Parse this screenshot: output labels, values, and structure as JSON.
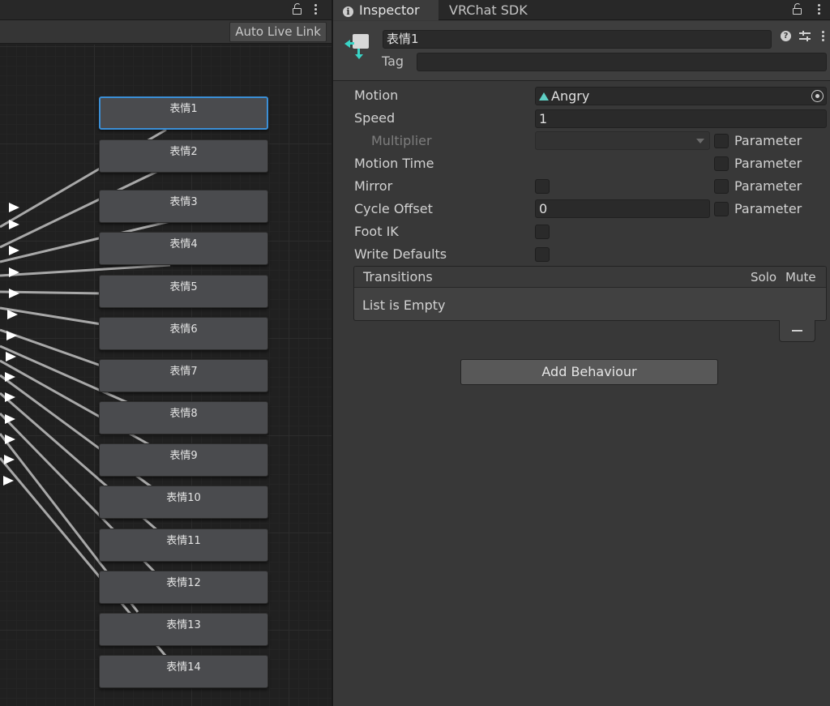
{
  "graph": {
    "auto_live_link_label": "Auto Live Link",
    "states": [
      {
        "name": "表情1",
        "selected": true
      },
      {
        "name": "表情2"
      },
      {
        "name": "表情3"
      },
      {
        "name": "表情4"
      },
      {
        "name": "表情5"
      },
      {
        "name": "表情6"
      },
      {
        "name": "表情7"
      },
      {
        "name": "表情8"
      },
      {
        "name": "表情9"
      },
      {
        "name": "表情10"
      },
      {
        "name": "表情11"
      },
      {
        "name": "表情12"
      },
      {
        "name": "表情13"
      },
      {
        "name": "表情14"
      }
    ]
  },
  "inspector": {
    "tabs": {
      "inspector": "Inspector",
      "vrchat_sdk": "VRChat SDK"
    },
    "header": {
      "state_name": "表情1",
      "tag_label": "Tag",
      "tag_value": ""
    },
    "properties": {
      "motion_label": "Motion",
      "motion_value": "Angry",
      "speed_label": "Speed",
      "speed_value": "1",
      "multiplier_label": "Multiplier",
      "motion_time_label": "Motion Time",
      "mirror_label": "Mirror",
      "cycle_offset_label": "Cycle Offset",
      "cycle_offset_value": "0",
      "foot_ik_label": "Foot IK",
      "write_defaults_label": "Write Defaults",
      "parameter_label": "Parameter"
    },
    "transitions": {
      "title": "Transitions",
      "solo_label": "Solo",
      "mute_label": "Mute",
      "empty_text": "List is Empty"
    },
    "add_behaviour_label": "Add Behaviour"
  },
  "colors": {
    "selection_outline": "#3b8fd6",
    "clip_icon": "#5fcfc4",
    "state_icon_arrows": "#39d4c6"
  }
}
